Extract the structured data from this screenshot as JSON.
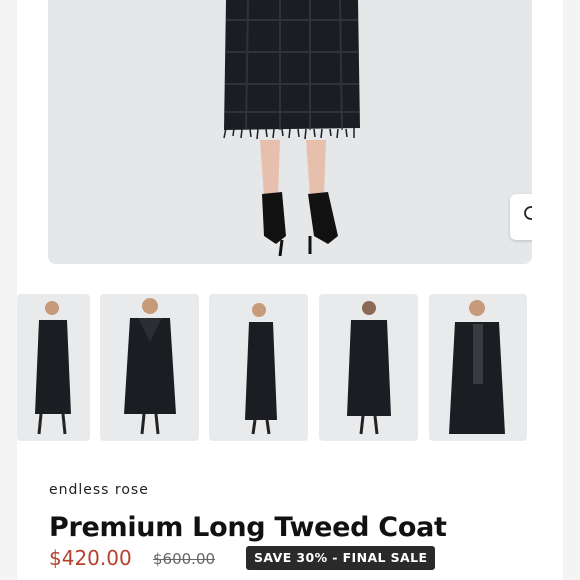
{
  "product": {
    "brand": "endless rose",
    "title": "Premium Long Tweed Coat",
    "price": "$420.00",
    "original_price": "$600.00",
    "badge": "SAVE 30% - FINAL SALE"
  },
  "gallery": {
    "zoom_icon": "magnifier-icon",
    "thumbnail_count": 5
  },
  "colors": {
    "price": "#b5412c",
    "badge_bg": "#2a2a2a",
    "coat": "#1c1d22"
  }
}
